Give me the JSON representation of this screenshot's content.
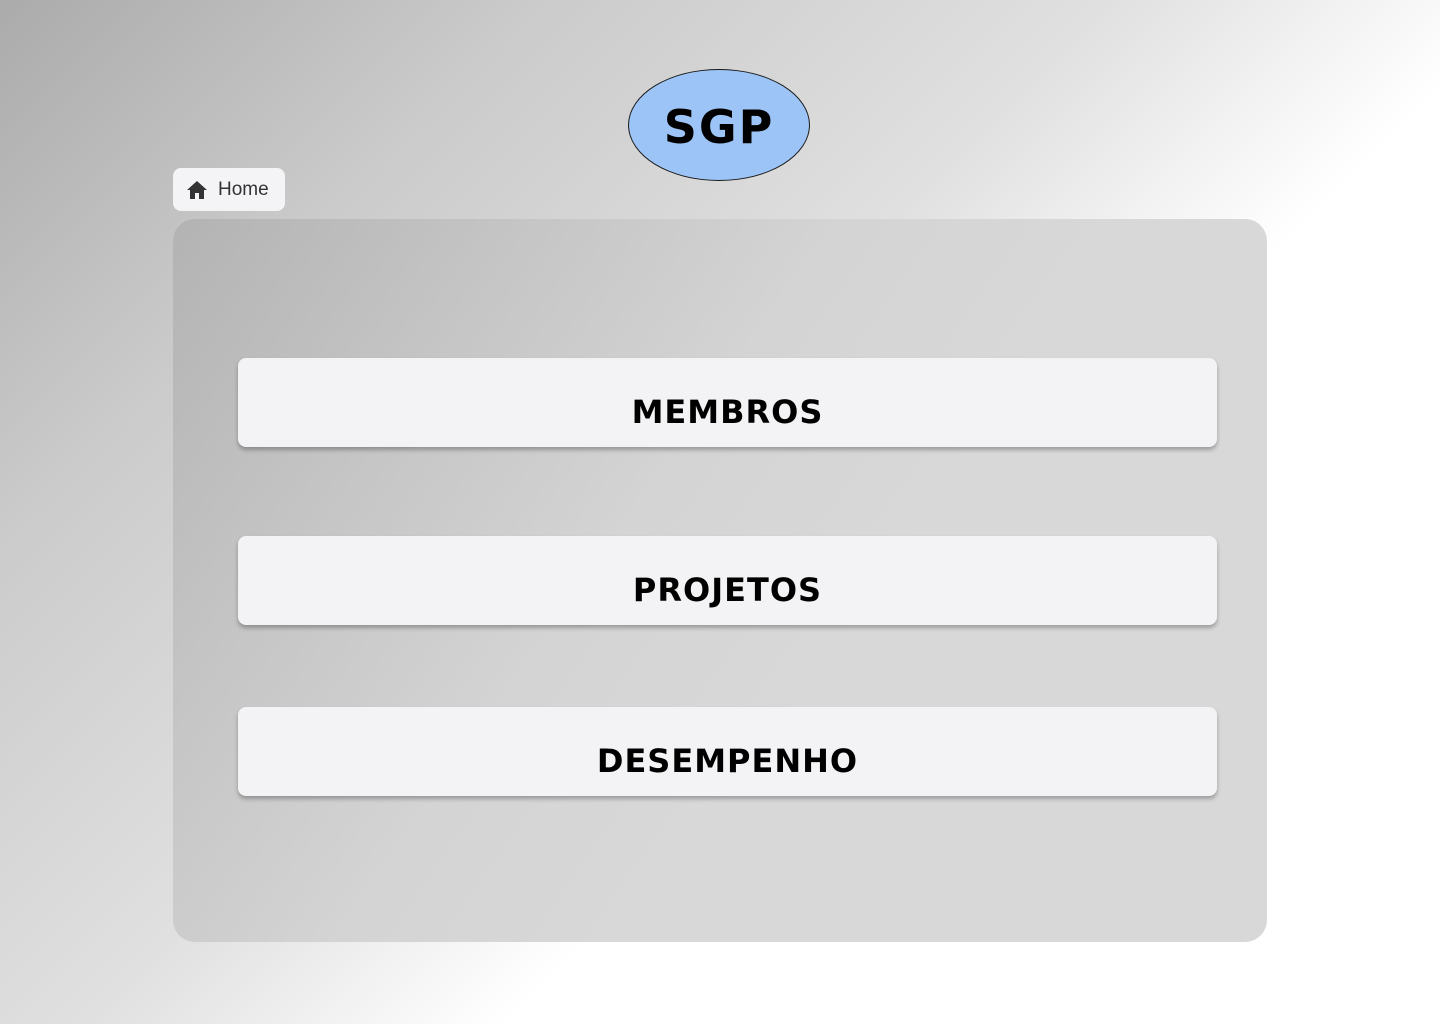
{
  "logo": {
    "text": "SGP",
    "color": "#9cc4f6"
  },
  "breadcrumb": {
    "icon": "home-icon",
    "label": "Home"
  },
  "menu": {
    "items": [
      {
        "label": "MEMBROS"
      },
      {
        "label": "PROJETOS"
      },
      {
        "label": "DESEMPENHO"
      }
    ]
  },
  "colors": {
    "button_background": "#f3f2f5",
    "panel_background": "#d8d8d8"
  }
}
